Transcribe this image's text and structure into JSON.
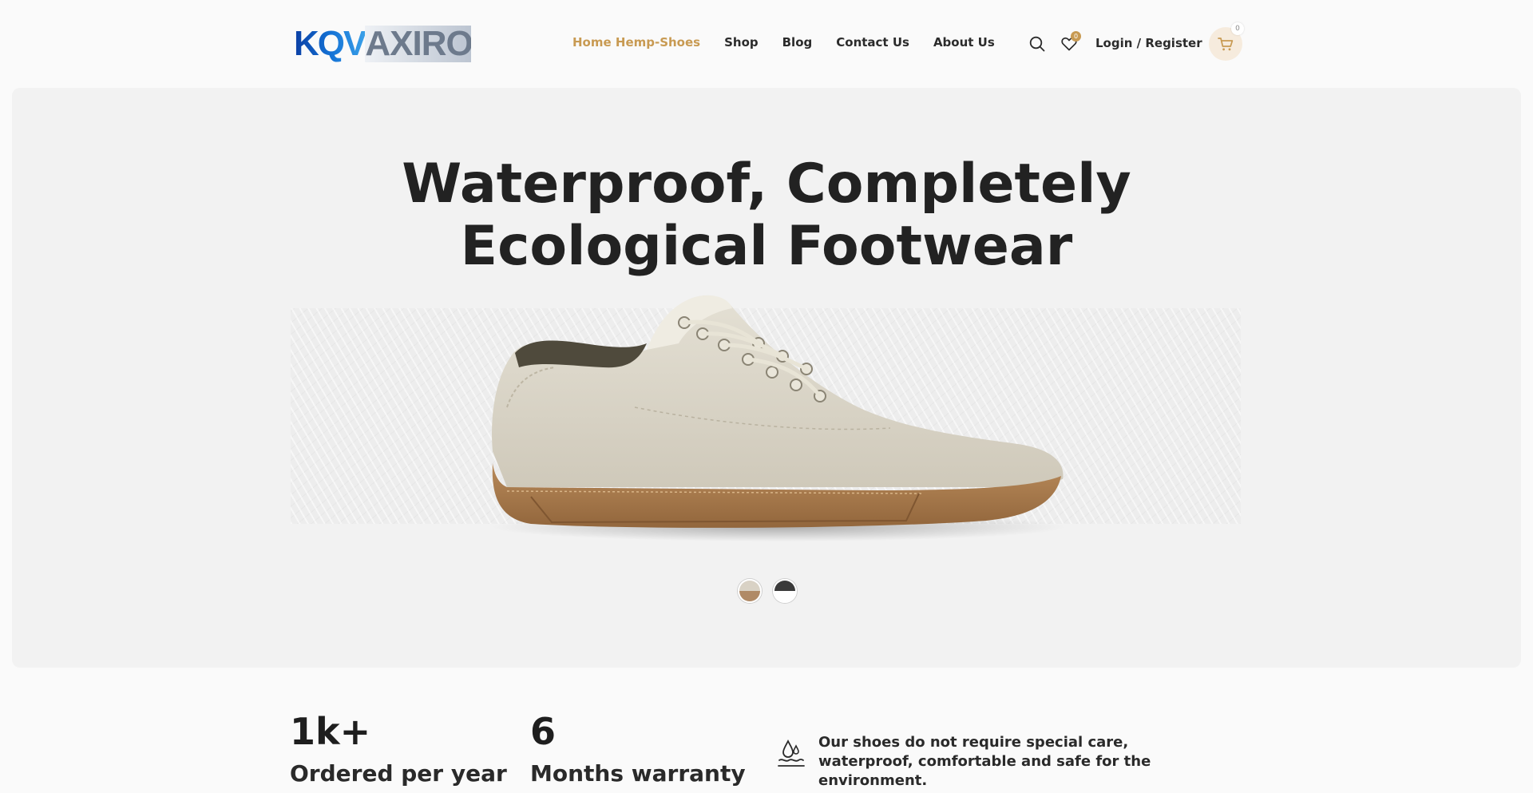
{
  "header": {
    "logo": {
      "part1": "KQV",
      "part2": "AXIRO"
    },
    "nav": [
      {
        "label": "Home Hemp-Shoes",
        "active": true
      },
      {
        "label": "Shop",
        "active": false
      },
      {
        "label": "Blog",
        "active": false
      },
      {
        "label": "Contact Us",
        "active": false
      },
      {
        "label": "About Us",
        "active": false
      }
    ],
    "search_icon": "search-icon",
    "wishlist": {
      "icon": "heart-icon",
      "count": "0"
    },
    "login_label": "Login / Register",
    "cart": {
      "icon": "cart-icon",
      "count": "0"
    }
  },
  "hero": {
    "title_line1": "Waterproof, Completely",
    "title_line2": "Ecological Footwear",
    "variants": [
      {
        "name": "beige",
        "top_color": "#d9d2c5",
        "bottom_color": "#b08a66"
      },
      {
        "name": "dark",
        "top_color": "#3a3a3a",
        "bottom_color": "#ffffff"
      }
    ]
  },
  "stats": [
    {
      "value": "1k+",
      "label": "Ordered per year"
    },
    {
      "value": "6",
      "label": "Months warranty"
    }
  ],
  "feature": {
    "icon": "water-drop-icon",
    "text": "Our shoes do not require special care, waterproof, comfortable and safe for the environment."
  },
  "colors": {
    "accent": "#c89a52",
    "text": "#242424",
    "hero_bg": "#f2f2f2",
    "page_bg": "#fafafa"
  }
}
